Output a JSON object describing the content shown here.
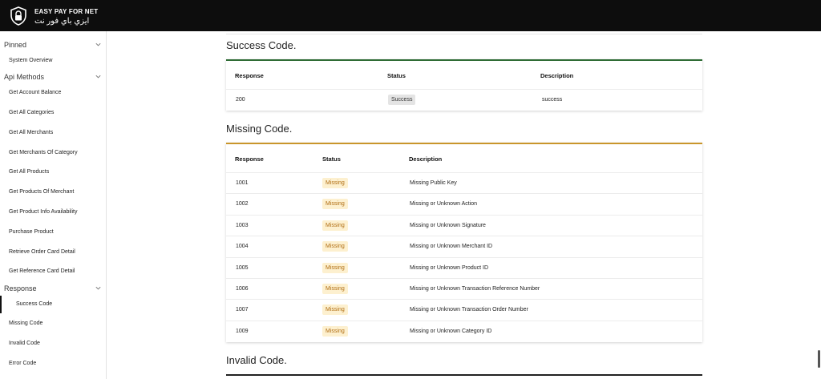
{
  "brand": {
    "name_en": "EASY PAY FOR NET",
    "name_ar": "ايزي باي فور نت"
  },
  "sidebar": {
    "sections": [
      {
        "label": "Pinned",
        "items": [
          "System Overview"
        ]
      },
      {
        "label": "Api Methods",
        "items": [
          "Get Account Balance",
          "Get All Categories",
          "Get All Merchants",
          "Get Merchants Of Category",
          "Get All Products",
          "Get Products Of Merchant",
          "Get Product Info Availability",
          "Purchase Product",
          "Retrieve Order Card Detail",
          "Get Reference Card Detail"
        ]
      },
      {
        "label": "Response",
        "items": [
          "Success Code",
          "Missing Code",
          "Invalid Code",
          "Error Code"
        ]
      }
    ],
    "active_item": "Success Code"
  },
  "success_section": {
    "title": "Success Code.",
    "accent_color": "#2e6b34",
    "headers": [
      "Response",
      "Status",
      "Description"
    ],
    "rows": [
      {
        "response": "200",
        "status": "Success",
        "description": "success"
      }
    ]
  },
  "missing_section": {
    "title": "Missing Code.",
    "accent_color": "#c9962b",
    "headers": [
      "Response",
      "Status",
      "Description"
    ],
    "rows": [
      {
        "response": "1001",
        "status": "Missing",
        "description": "Missing Public Key"
      },
      {
        "response": "1002",
        "status": "Missing",
        "description": "Missing or Unknown Action"
      },
      {
        "response": "1003",
        "status": "Missing",
        "description": "Missing or Unknown Signature"
      },
      {
        "response": "1004",
        "status": "Missing",
        "description": "Missing or Unknown Merchant ID"
      },
      {
        "response": "1005",
        "status": "Missing",
        "description": "Missing or Unknown Product ID"
      },
      {
        "response": "1006",
        "status": "Missing",
        "description": "Missing or Unknown Transaction Reference Number"
      },
      {
        "response": "1007",
        "status": "Missing",
        "description": "Missing or Unknown Transaction Order Number"
      },
      {
        "response": "1009",
        "status": "Missing",
        "description": "Missing or Unknown Category ID"
      }
    ]
  },
  "invalid_section": {
    "title": "Invalid Code.",
    "accent_color": "#222222"
  }
}
